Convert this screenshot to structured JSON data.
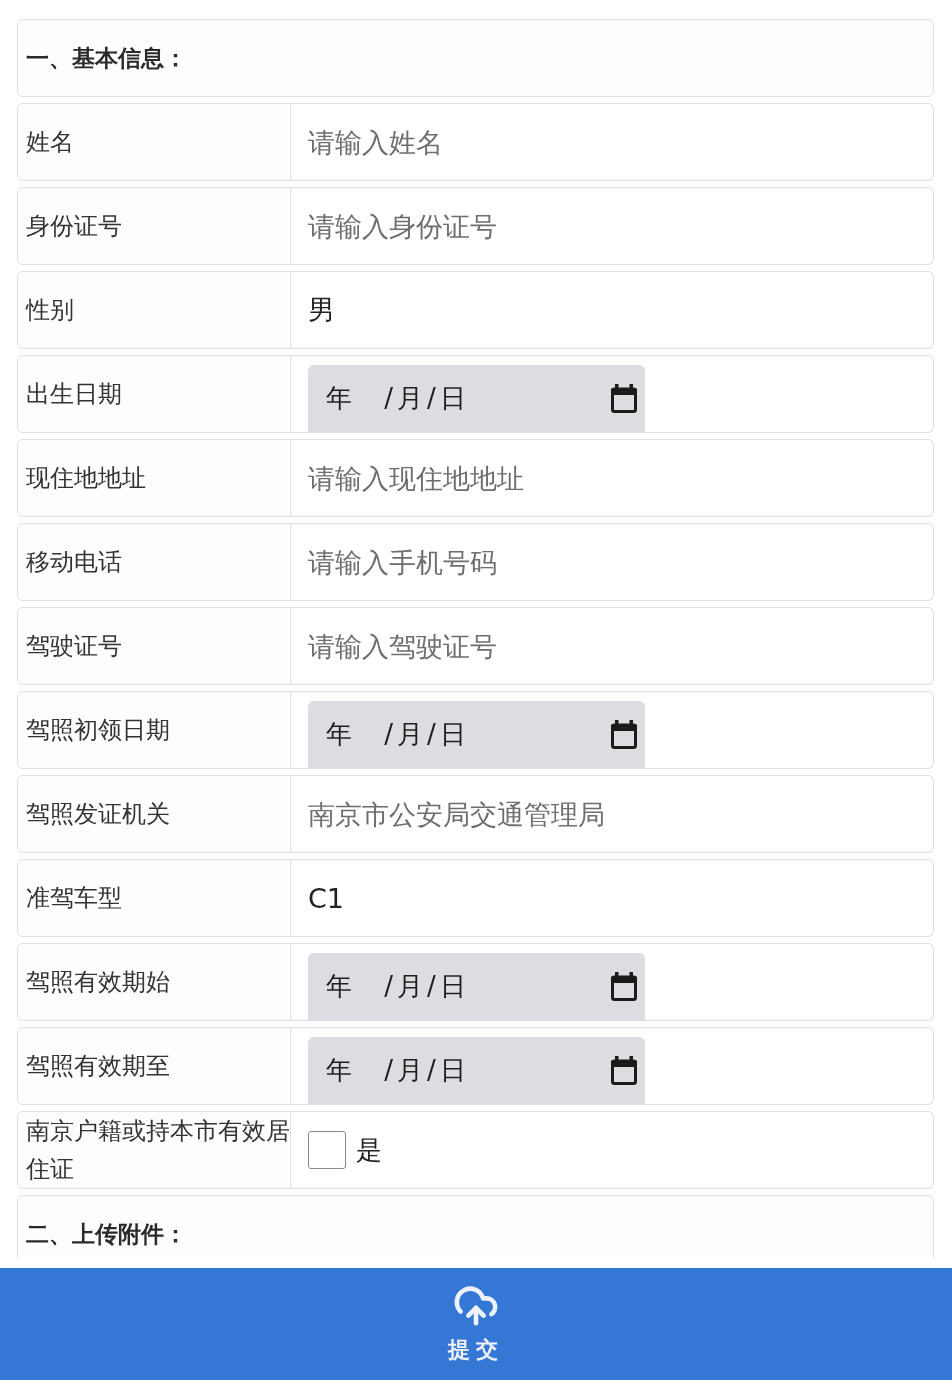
{
  "sections": [
    {
      "title": "一、基本信息：",
      "fields": [
        {
          "label": "姓名",
          "kind": "text",
          "placeholder": "请输入姓名"
        },
        {
          "label": "身份证号",
          "kind": "text",
          "placeholder": "请输入身份证号"
        },
        {
          "label": "性别",
          "kind": "text",
          "value": "男"
        },
        {
          "label": "出生日期",
          "kind": "date",
          "placeholder": "年 /月/日"
        },
        {
          "label": "现住地地址",
          "kind": "text",
          "placeholder": "请输入现住地地址"
        },
        {
          "label": "移动电话",
          "kind": "text",
          "placeholder": "请输入手机号码"
        },
        {
          "label": "驾驶证号",
          "kind": "text",
          "placeholder": "请输入驾驶证号"
        },
        {
          "label": "驾照初领日期",
          "kind": "date",
          "placeholder": "年 /月/日"
        },
        {
          "label": "驾照发证机关",
          "kind": "text",
          "placeholder": "南京市公安局交通管理局"
        },
        {
          "label": "准驾车型",
          "kind": "text",
          "value": "C1"
        },
        {
          "label": "驾照有效期始",
          "kind": "date",
          "placeholder": "年 /月/日"
        },
        {
          "label": "驾照有效期至",
          "kind": "date",
          "placeholder": "年 /月/日"
        },
        {
          "label": "南京户籍或持本市有效居住证",
          "kind": "checkbox",
          "option": "是",
          "checked": false
        }
      ]
    },
    {
      "title": "二、上传附件："
    }
  ],
  "footer": {
    "submit_button": {
      "label": "提交"
    }
  }
}
